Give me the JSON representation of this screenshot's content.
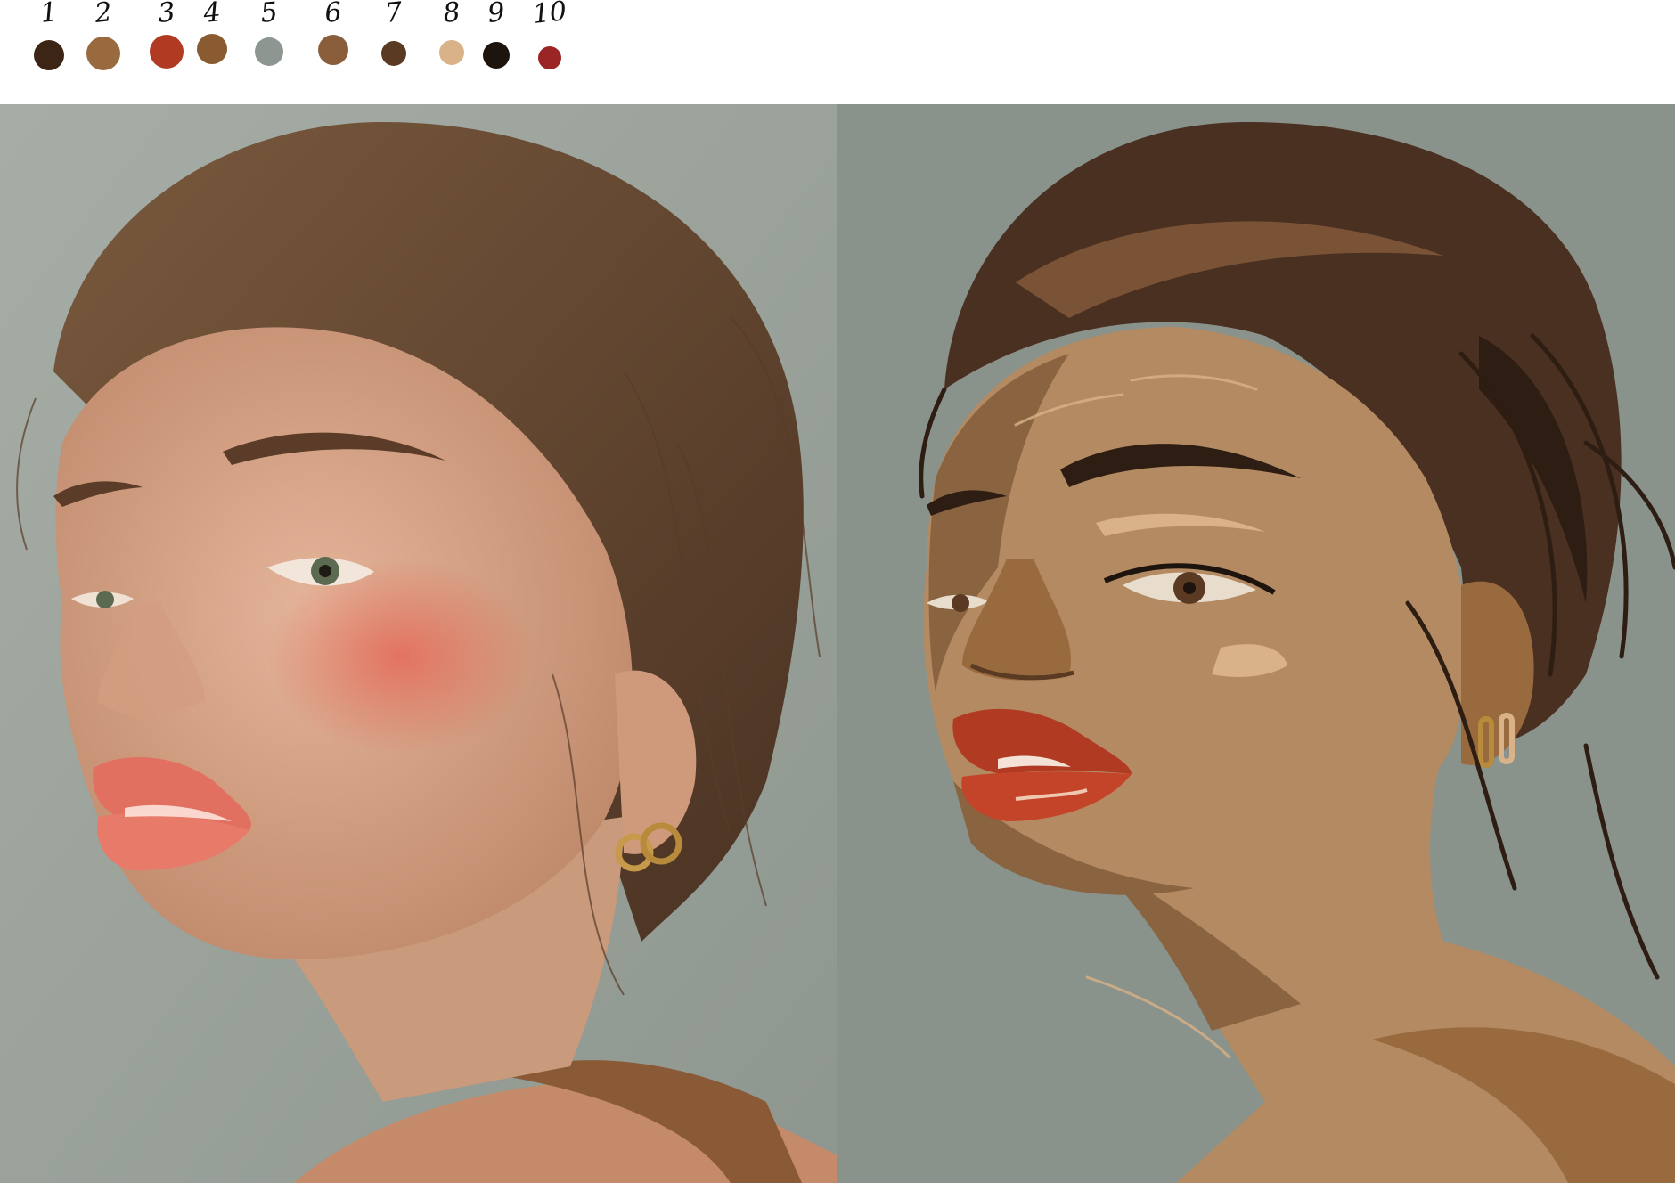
{
  "palette": [
    {
      "label": "1",
      "color": "#3d2515"
    },
    {
      "label": "2",
      "color": "#9a6a3f"
    },
    {
      "label": "3",
      "color": "#b13a22"
    },
    {
      "label": "4",
      "color": "#8a5a30"
    },
    {
      "label": "5",
      "color": "#8d9690"
    },
    {
      "label": "6",
      "color": "#8a5e3b"
    },
    {
      "label": "7",
      "color": "#5a3a22"
    },
    {
      "label": "8",
      "color": "#d9b287"
    },
    {
      "label": "9",
      "color": "#1e140e"
    },
    {
      "label": "10",
      "color": "#9b2525"
    }
  ],
  "colors": {
    "photo_bg": "#9aa39b",
    "art_bg": "#8a928c",
    "skin": "#b48a62",
    "skin_shadow": "#8a6440",
    "hair": "#4a3020",
    "lips": "#b13a22"
  }
}
